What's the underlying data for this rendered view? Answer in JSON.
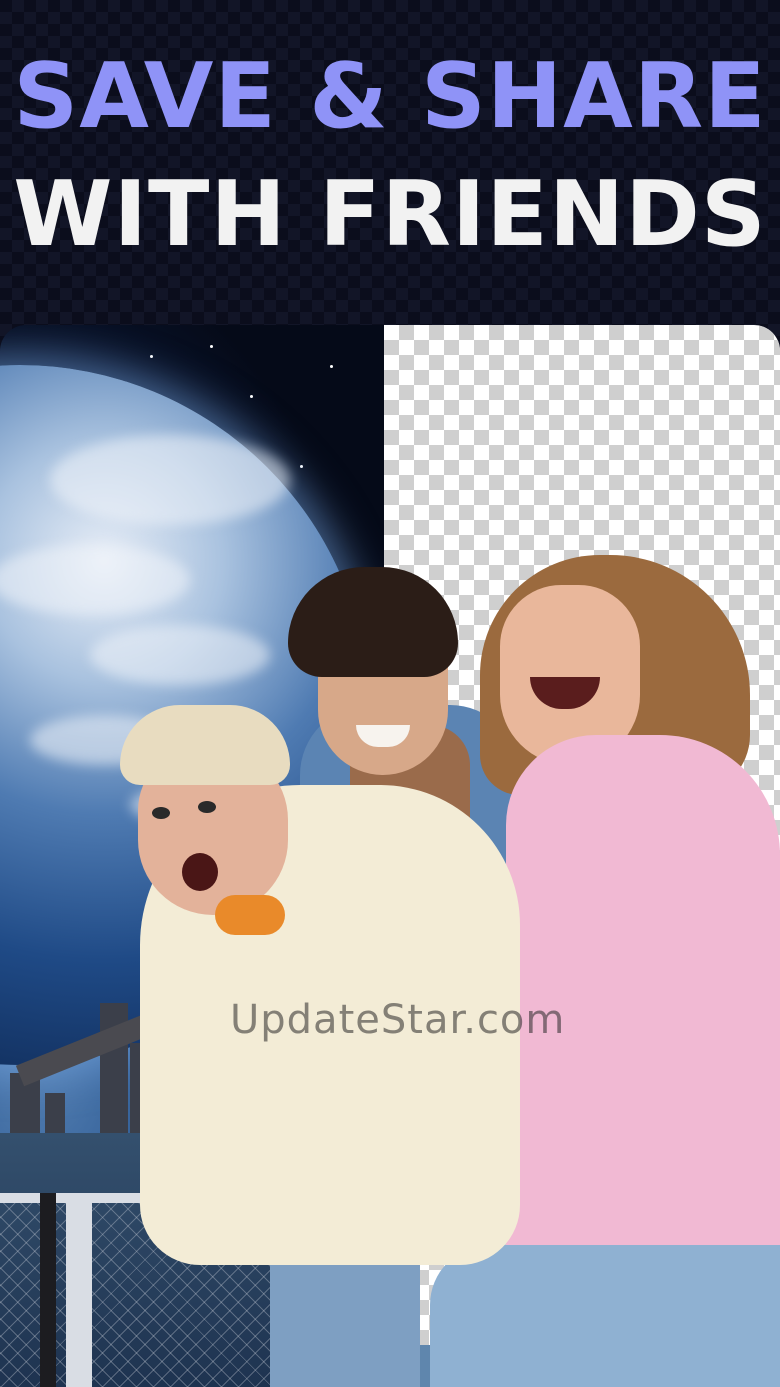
{
  "headline": {
    "line1": "SAVE & SHARE",
    "line2": "WITH FRIENDS",
    "line1_color": "#8f93f7",
    "line2_color": "#f2f2f2"
  },
  "watermark": "UpdateStar.com",
  "colors": {
    "background": "#0d0f1f",
    "checker_light": "#ffffff",
    "checker_dark": "#cfcfcf",
    "hoodie_cream": "#f3ecd6",
    "hoodie_pink": "#f1b9d3"
  },
  "scene": {
    "left_background": "earth-from-space",
    "right_background": "transparent-checkerboard",
    "subjects": [
      "person-blonde-cream-hoodie",
      "person-dark-hair-denim-jacket",
      "person-long-hair-pink-hoodie"
    ]
  }
}
